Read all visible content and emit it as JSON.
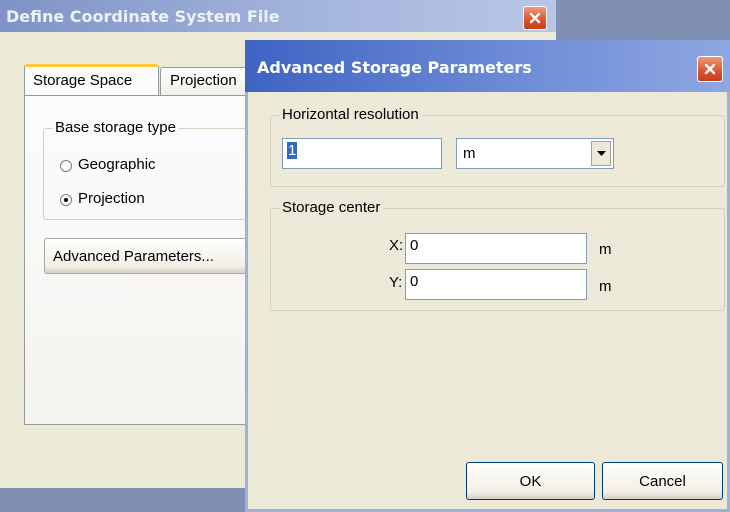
{
  "main_window": {
    "title": "Define Coordinate System File",
    "tabs": [
      "Storage Space",
      "Projection"
    ],
    "base_storage_type": {
      "label": "Base storage type",
      "options": [
        "Geographic",
        "Projection"
      ],
      "selected": "Projection"
    },
    "advanced_button": "Advanced Parameters..."
  },
  "dialog": {
    "title": "Advanced Storage Parameters",
    "horizontal_resolution": {
      "label": "Horizontal resolution",
      "value": "1",
      "unit": "m"
    },
    "storage_center": {
      "label": "Storage center",
      "x_label": "X:",
      "x_value": "0",
      "x_unit": "m",
      "y_label": "Y:",
      "y_value": "0",
      "y_unit": "m"
    },
    "ok": "OK",
    "cancel": "Cancel"
  },
  "icons": [
    "close-icon",
    "dropdown-arrow-icon",
    "radio-icon"
  ]
}
